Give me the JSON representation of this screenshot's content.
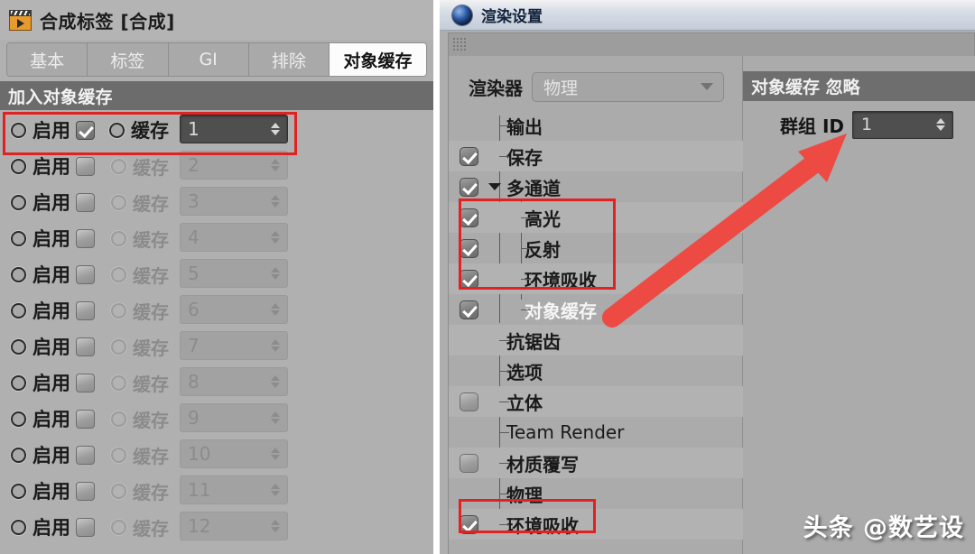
{
  "left_panel": {
    "title": "合成标签 [合成]",
    "title_icon": "film-clapper-icon",
    "tabs": [
      {
        "label": "基本",
        "active": false
      },
      {
        "label": "标签",
        "active": false
      },
      {
        "label": "GI",
        "active": false
      },
      {
        "label": "排除",
        "active": false
      },
      {
        "label": "对象缓存",
        "active": true
      }
    ],
    "section_header": "加入对象缓存",
    "column_labels": {
      "enable": "启用",
      "buffer": "缓存"
    },
    "rows": [
      {
        "index": 1,
        "enable_label": "启用",
        "enabled": true,
        "buffer_label": "缓存",
        "value": "1"
      },
      {
        "index": 2,
        "enable_label": "启用",
        "enabled": false,
        "buffer_label": "缓存",
        "value": "2"
      },
      {
        "index": 3,
        "enable_label": "启用",
        "enabled": false,
        "buffer_label": "缓存",
        "value": "3"
      },
      {
        "index": 4,
        "enable_label": "启用",
        "enabled": false,
        "buffer_label": "缓存",
        "value": "4"
      },
      {
        "index": 5,
        "enable_label": "启用",
        "enabled": false,
        "buffer_label": "缓存",
        "value": "5"
      },
      {
        "index": 6,
        "enable_label": "启用",
        "enabled": false,
        "buffer_label": "缓存",
        "value": "6"
      },
      {
        "index": 7,
        "enable_label": "启用",
        "enabled": false,
        "buffer_label": "缓存",
        "value": "7"
      },
      {
        "index": 8,
        "enable_label": "启用",
        "enabled": false,
        "buffer_label": "缓存",
        "value": "8"
      },
      {
        "index": 9,
        "enable_label": "启用",
        "enabled": false,
        "buffer_label": "缓存",
        "value": "9"
      },
      {
        "index": 10,
        "enable_label": "启用",
        "enabled": false,
        "buffer_label": "缓存",
        "value": "10"
      },
      {
        "index": 11,
        "enable_label": "启用",
        "enabled": false,
        "buffer_label": "缓存",
        "value": "11"
      },
      {
        "index": 12,
        "enable_label": "启用",
        "enabled": false,
        "buffer_label": "缓存",
        "value": "12"
      }
    ]
  },
  "right_panel": {
    "title": "渲染设置",
    "title_icon": "blue-sphere-icon",
    "renderer": {
      "label": "渲染器",
      "value": "物理"
    },
    "tree": [
      {
        "label": "输出",
        "checkbox": "none",
        "indent": 1,
        "selected": false
      },
      {
        "label": "保存",
        "checkbox": "checked",
        "indent": 1,
        "selected": false
      },
      {
        "label": "多通道",
        "checkbox": "checked",
        "indent": 1,
        "selected": false,
        "expander": "down"
      },
      {
        "label": "高光",
        "checkbox": "checked",
        "indent": 2,
        "selected": false
      },
      {
        "label": "反射",
        "checkbox": "checked",
        "indent": 2,
        "selected": false
      },
      {
        "label": "环境吸收",
        "checkbox": "checked",
        "indent": 2,
        "selected": false
      },
      {
        "label": "对象缓存",
        "checkbox": "checked",
        "indent": 2,
        "selected": true
      },
      {
        "label": "抗锯齿",
        "checkbox": "none",
        "indent": 1,
        "selected": false
      },
      {
        "label": "选项",
        "checkbox": "none",
        "indent": 1,
        "selected": false
      },
      {
        "label": "立体",
        "checkbox": "unchecked",
        "indent": 1,
        "selected": false
      },
      {
        "label": "Team Render",
        "checkbox": "none",
        "indent": 1,
        "selected": false,
        "latin": true
      },
      {
        "label": "材质覆写",
        "checkbox": "unchecked",
        "indent": 1,
        "selected": false
      },
      {
        "label": "物理",
        "checkbox": "none",
        "indent": 1,
        "selected": false
      },
      {
        "label": "环境吸收",
        "checkbox": "checked",
        "indent": 1,
        "selected": false
      }
    ],
    "object_buffer": {
      "header": "对象缓存 忽略",
      "group_id_label": "群组 ID",
      "group_id_value": "1"
    }
  },
  "annotations": {
    "accent_color": "#e02222",
    "arrow_color": "#ec4a42",
    "watermark": "头条 @数艺设"
  }
}
